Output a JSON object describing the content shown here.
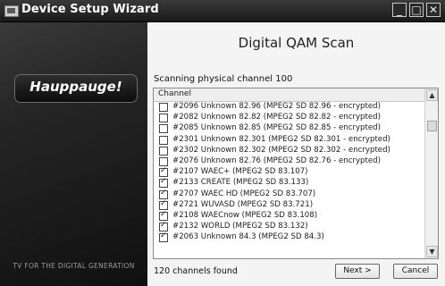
{
  "window": {
    "title": "Device Setup Wizard",
    "controls": {
      "minimize": "_",
      "maximize": "□",
      "close": "✕"
    }
  },
  "brand": {
    "logo_text": "Hauppauge!",
    "tagline": "TV FOR THE DIGITAL GENERATION"
  },
  "page": {
    "heading": "Digital QAM Scan",
    "status": "Scanning physical channel 100",
    "found": "120 channels found"
  },
  "list": {
    "column_header": "Channel",
    "rows": [
      {
        "text": "#2096   Unknown 82.96   (MPEG2 SD 82.96 - encrypted)",
        "checked": false
      },
      {
        "text": "#2082   Unknown 82.82   (MPEG2 SD 82.82 - encrypted)",
        "checked": false
      },
      {
        "text": "#2085   Unknown 82.85   (MPEG2 SD 82.85 - encrypted)",
        "checked": false
      },
      {
        "text": "#2301   Unknown 82.301   (MPEG2 SD 82.301 - encrypted)",
        "checked": false
      },
      {
        "text": "#2302   Unknown 82.302   (MPEG2 SD 82.302 - encrypted)",
        "checked": false
      },
      {
        "text": "#2076   Unknown 82.76   (MPEG2 SD 82.76 - encrypted)",
        "checked": false
      },
      {
        "text": "#2107   WAEC+   (MPEG2 SD 83.107)",
        "checked": true
      },
      {
        "text": "#2133   CREATE   (MPEG2 SD 83.133)",
        "checked": true
      },
      {
        "text": "#2707   WAEC HD   (MPEG2 SD 83.707)",
        "checked": true
      },
      {
        "text": "#2721   WUVASD   (MPEG2 SD 83.721)",
        "checked": true
      },
      {
        "text": "#2108   WAECnow   (MPEG2 SD 83.108)",
        "checked": true
      },
      {
        "text": "#2132   WORLD   (MPEG2 SD 83.132)",
        "checked": true
      },
      {
        "text": "#2063   Unknown 84.3   (MPEG2 SD 84.3)",
        "checked": true
      }
    ],
    "scroll_up_glyph": "▲",
    "scroll_down_glyph": "▼"
  },
  "buttons": {
    "next": "Next >",
    "cancel": "Cancel"
  }
}
